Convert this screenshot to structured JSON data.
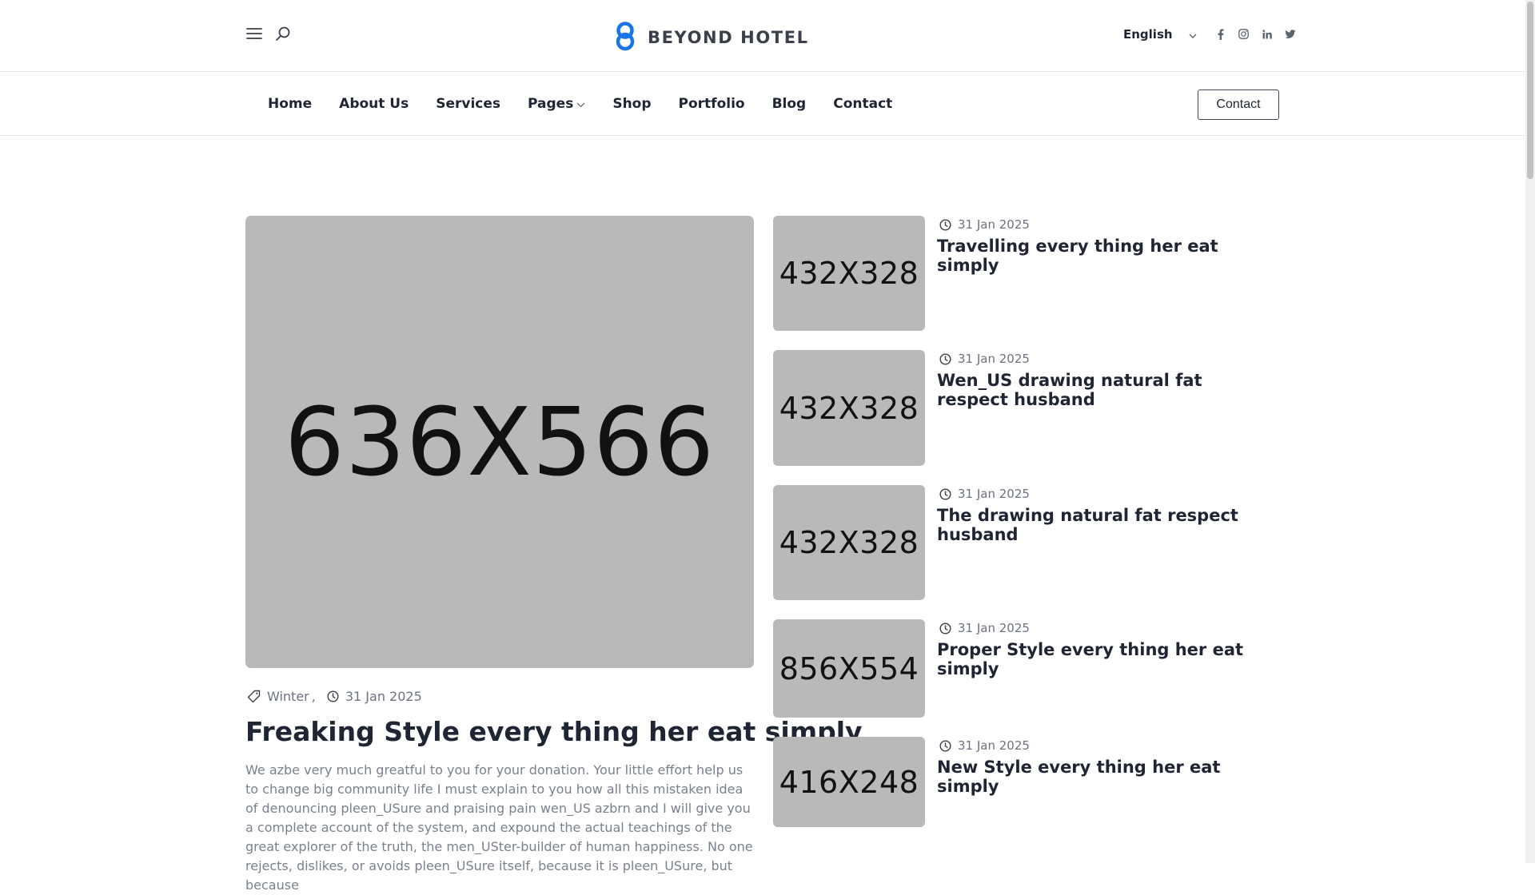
{
  "header": {
    "logo_text": "BEYOND HOTEL",
    "language": "English",
    "social_icons": [
      "facebook-icon",
      "instagram-icon",
      "linkedin-icon",
      "twitter-icon"
    ]
  },
  "nav": {
    "items": [
      {
        "label": "Home"
      },
      {
        "label": "About Us"
      },
      {
        "label": "Services"
      },
      {
        "label": "Pages",
        "has_dropdown": true
      },
      {
        "label": "Shop"
      },
      {
        "label": "Portfolio"
      },
      {
        "label": "Blog"
      },
      {
        "label": "Contact"
      }
    ],
    "contact_button": "Contact"
  },
  "feature": {
    "image_label": "636X566",
    "category": "Winter",
    "category_separator": ",",
    "date": "31 Jan 2025",
    "title": "Freaking Style every thing her eat simply",
    "excerpt": "We azbe very much greatful to you for your donation. Your little effort help us to change big community life I must explain to you how all this mistaken idea of denouncing pleen_USure and praising pain wen_US azbrn and I will give you a complete account of the system, and expound the actual teachings of the great explorer of the truth, the men_USter-builder of human happiness. No one rejects, dislikes, or avoids pleen_USure itself, because it is pleen_USure, but because"
  },
  "posts": [
    {
      "image_label": "432X328",
      "date": "31 Jan 2025",
      "title": "Travelling every thing her eat simply"
    },
    {
      "image_label": "432X328",
      "date": "31 Jan 2025",
      "title": "Wen_US drawing natural fat respect husband"
    },
    {
      "image_label": "432X328",
      "date": "31 Jan 2025",
      "title": "The drawing natural fat respect husband"
    },
    {
      "image_label": "856X554",
      "date": "31 Jan 2025",
      "title": "Proper Style every thing her eat simply"
    },
    {
      "image_label": "416X248",
      "date": "31 Jan 2025",
      "title": "New Style every thing her eat simply"
    }
  ],
  "colors": {
    "text": "#1f2533",
    "muted": "#6b7280",
    "placeholder": "#b9b9b9",
    "logo_accent": "#1a73e8",
    "border": "#e4e6ea"
  }
}
